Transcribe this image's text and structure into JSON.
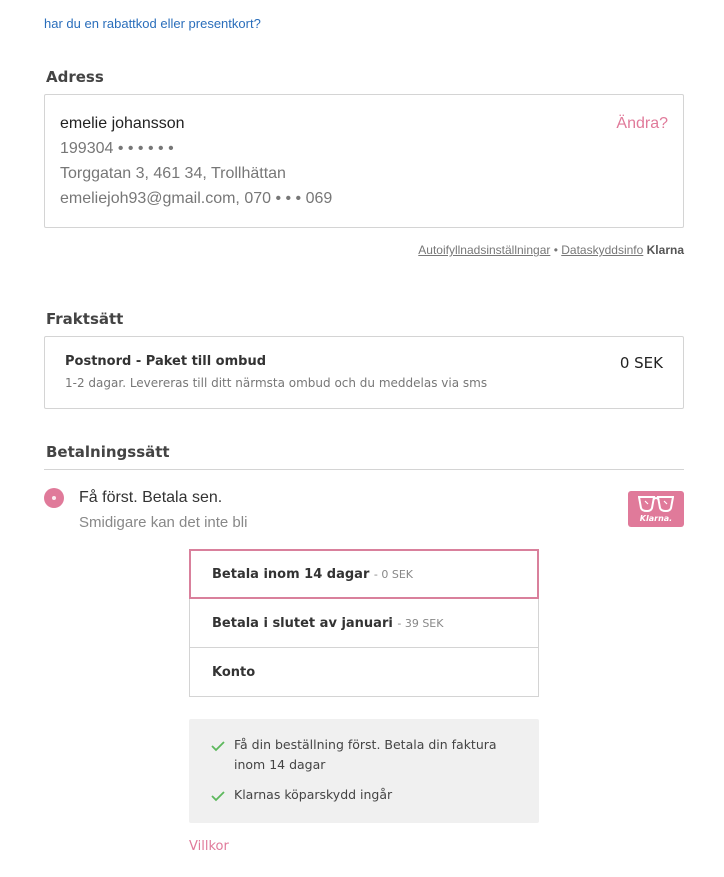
{
  "discount_link": "har du en rabattkod eller presentkort?",
  "address": {
    "title": "Adress",
    "name": "emelie johansson",
    "personal_number": "199304 • •    • • • •",
    "street": "Torggatan 3, 461 34, Trollhättan",
    "contact": "emeliejoh93@gmail.com, 070  • • • 069",
    "change_label": "Ändra?"
  },
  "klarna_links": {
    "autofill": "Autoifyllnadsinställningar",
    "separator": "•",
    "privacy": "Dataskyddsinfo",
    "brand": "Klarna"
  },
  "shipping": {
    "title": "Fraktsätt",
    "method": "Postnord - Paket till ombud",
    "description": "1-2 dagar. Levereras till ditt närmsta ombud och du meddelas via sms",
    "price": "0 SEK"
  },
  "payment": {
    "title": "Betalningssätt",
    "option_title": "Få först. Betala sen.",
    "option_subtitle": "Smidigare kan det inte bli",
    "badge_text": "Klarna.",
    "choices": [
      {
        "label": "Betala inom 14 dagar",
        "fee": "- 0 SEK",
        "selected": true
      },
      {
        "label": "Betala i slutet av januari",
        "fee": "- 39 SEK",
        "selected": false
      },
      {
        "label": "Konto",
        "fee": "",
        "selected": false
      }
    ],
    "benefits": [
      "Få din beställning först. Betala din faktura inom 14 dagar",
      "Klarnas köparskydd ingår"
    ],
    "terms_label": "Villkor"
  },
  "colors": {
    "accent": "#e07a9a",
    "link": "#2a6ebb",
    "check": "#5cb85c"
  }
}
